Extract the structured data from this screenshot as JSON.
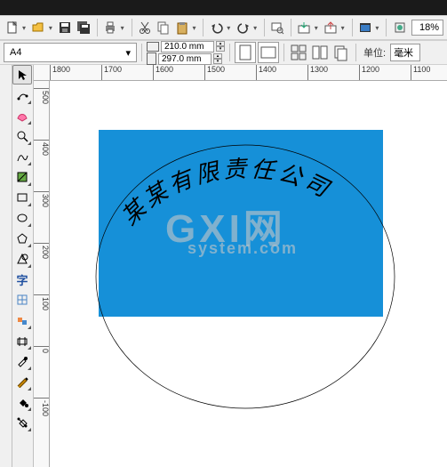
{
  "toolbar1": {
    "zoom": "18%"
  },
  "toolbar2": {
    "paper_size": "A4",
    "width": "210.0 mm",
    "height": "297.0 mm",
    "units_label": "单位:",
    "units_value": "毫米"
  },
  "ruler_h": [
    "1800",
    "1700",
    "1600",
    "1500",
    "1400",
    "1300",
    "1200",
    "1100"
  ],
  "ruler_v": [
    "500",
    "400",
    "300",
    "200",
    "100",
    "0",
    "-100"
  ],
  "canvas": {
    "arc_text": "某某有限责任公司",
    "watermark_main": "GXI网",
    "watermark_sub": "system.com"
  }
}
